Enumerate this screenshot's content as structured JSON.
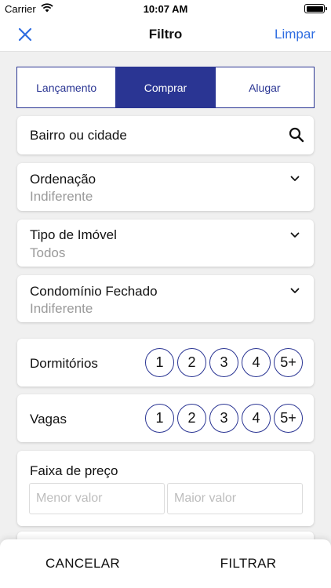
{
  "status_bar": {
    "carrier": "Carrier",
    "time": "10:07 AM",
    "icons": [
      "wifi-icon",
      "battery-icon"
    ]
  },
  "nav": {
    "close_icon": "close-icon",
    "title": "Filtro",
    "clear_label": "Limpar"
  },
  "colors": {
    "accent": "#2a3593",
    "link": "#2f6de1",
    "muted_text": "#9a9a9a"
  },
  "segment": {
    "options": [
      "Lançamento",
      "Comprar",
      "Alugar"
    ],
    "selected": "Comprar"
  },
  "location": {
    "label": "Bairro ou cidade",
    "icon": "search-icon"
  },
  "ordering": {
    "label": "Ordenação",
    "value": "Indiferente"
  },
  "property_type": {
    "label": "Tipo de Imóvel",
    "value": "Todos"
  },
  "gated": {
    "label": "Condomínio Fechado",
    "value": "Indiferente"
  },
  "bedrooms": {
    "label": "Dormitórios",
    "options": [
      "1",
      "2",
      "3",
      "4",
      "5+"
    ]
  },
  "parking": {
    "label": "Vagas",
    "options": [
      "1",
      "2",
      "3",
      "4",
      "5+"
    ]
  },
  "price": {
    "label": "Faixa de preço",
    "min_placeholder": "Menor valor",
    "max_placeholder": "Maior valor"
  },
  "footer": {
    "cancel_label": "CANCELAR",
    "filter_label": "FILTRAR"
  }
}
